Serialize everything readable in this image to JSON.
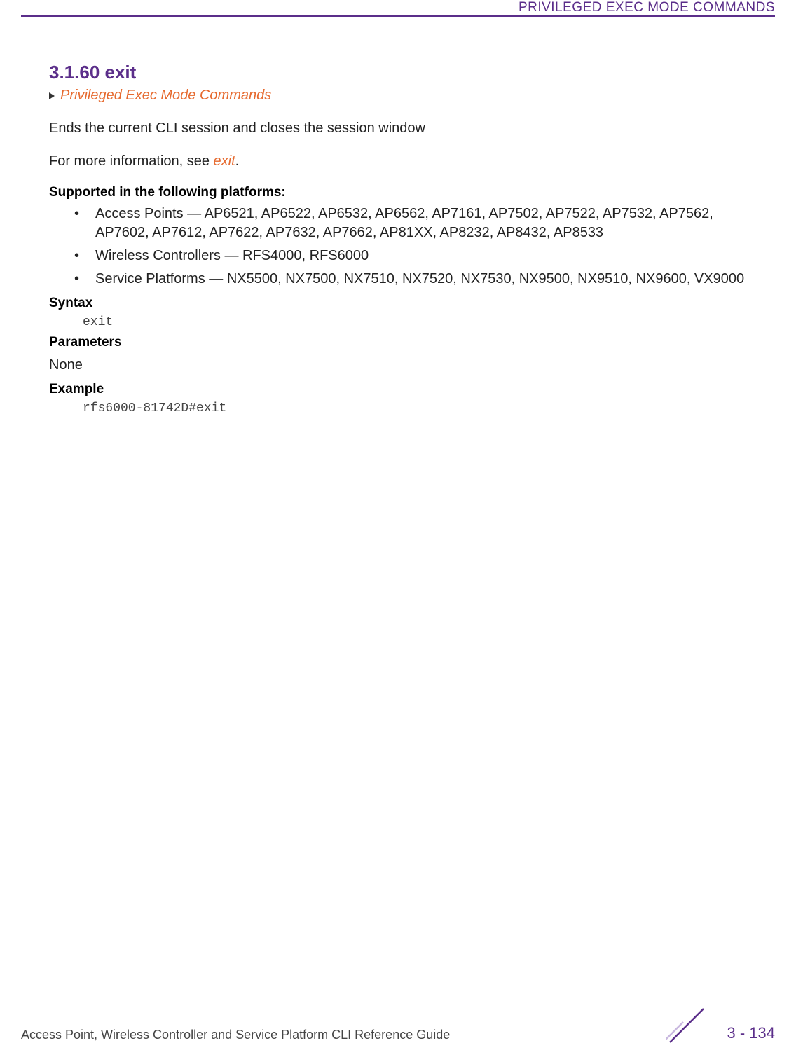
{
  "header": {
    "title": "PRIVILEGED EXEC MODE COMMANDS"
  },
  "section": {
    "number_title": "3.1.60 exit",
    "breadcrumb": "Privileged Exec Mode Commands",
    "description": "Ends the current CLI session and closes the session window",
    "more_info_prefix": "For more information, see ",
    "more_info_link": "exit",
    "more_info_suffix": "."
  },
  "supported": {
    "heading": "Supported in the following platforms:",
    "items": [
      "Access Points — AP6521, AP6522, AP6532, AP6562, AP7161, AP7502, AP7522, AP7532, AP7562, AP7602, AP7612, AP7622, AP7632, AP7662, AP81XX, AP8232, AP8432, AP8533",
      "Wireless Controllers — RFS4000, RFS6000",
      "Service Platforms — NX5500, NX7500, NX7510, NX7520, NX7530, NX9500, NX9510, NX9600, VX9000"
    ]
  },
  "syntax": {
    "heading": "Syntax",
    "code": "exit"
  },
  "parameters": {
    "heading": "Parameters",
    "value": "None"
  },
  "example": {
    "heading": "Example",
    "code": "rfs6000-81742D#exit"
  },
  "footer": {
    "title": "Access Point, Wireless Controller and Service Platform CLI Reference Guide",
    "page": "3 - 134"
  }
}
